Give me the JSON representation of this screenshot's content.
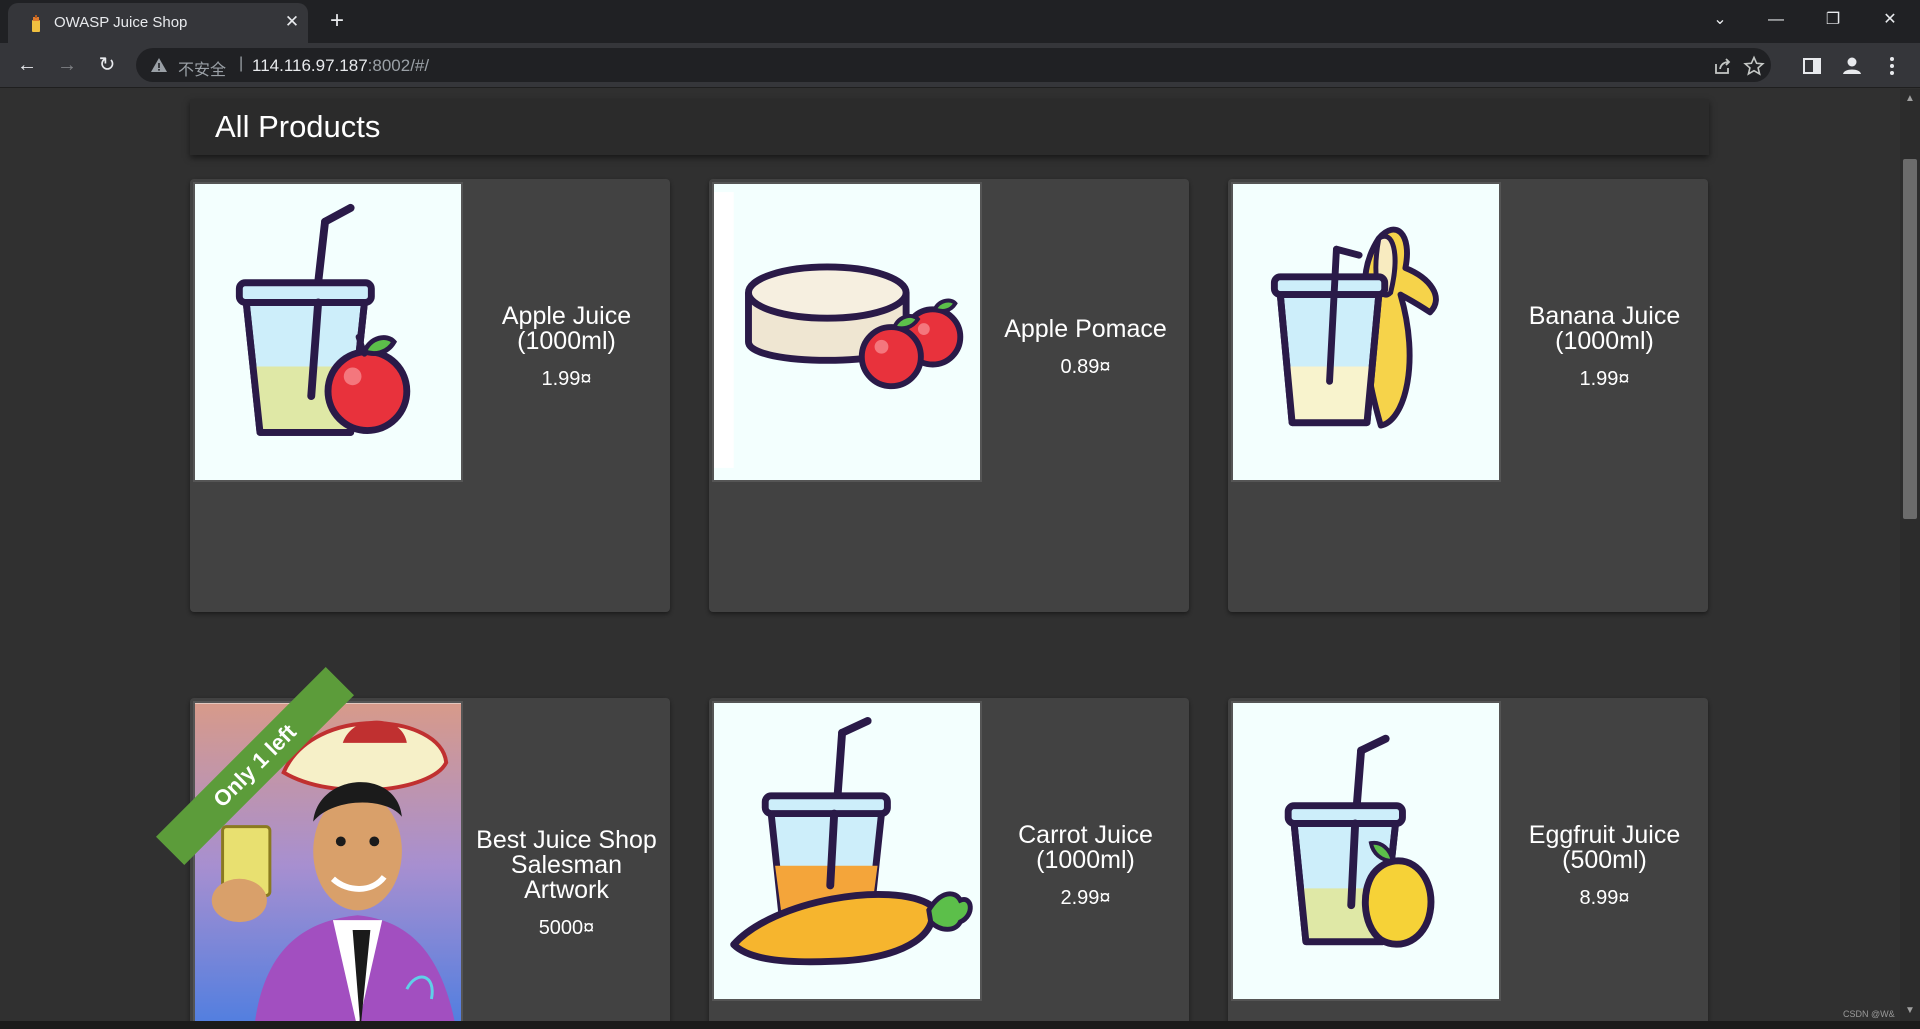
{
  "browser": {
    "tab_title": "OWASP Juice Shop",
    "tab_close": "✕",
    "new_tab": "+",
    "window_controls": {
      "dropdown": "⌄",
      "minimize": "—",
      "restore": "❐",
      "close": "✕"
    },
    "nav": {
      "back": "←",
      "forward": "→",
      "reload": "↻"
    },
    "security_label": "不安全",
    "separator": "|",
    "url_host": "114.116.97.187",
    "url_rest": ":8002/#/",
    "icons": [
      "share-icon",
      "star-icon",
      "side-panel-icon",
      "profile-icon",
      "menu-icon"
    ]
  },
  "main": {
    "heading": "All Products"
  },
  "products": [
    {
      "name_lines": [
        "Apple Juice",
        "(1000ml)"
      ],
      "price": "1.99¤"
    },
    {
      "name_lines": [
        "Apple Pomace"
      ],
      "price": "0.89¤"
    },
    {
      "name_lines": [
        "Banana Juice",
        "(1000ml)"
      ],
      "price": "1.99¤"
    },
    {
      "name_lines": [
        "Best Juice Shop",
        "Salesman",
        "Artwork"
      ],
      "price": "5000¤",
      "ribbon": "Only 1 left"
    },
    {
      "name_lines": [
        "Carrot Juice",
        "(1000ml)"
      ],
      "price": "2.99¤"
    },
    {
      "name_lines": [
        "Eggfruit Juice",
        "(500ml)"
      ],
      "price": "8.99¤"
    }
  ],
  "watermark": "CSDN @W&"
}
